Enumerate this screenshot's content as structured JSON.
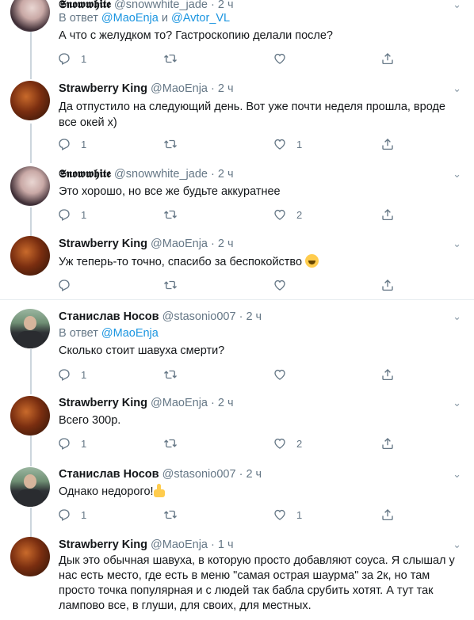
{
  "tweets": [
    {
      "avatar": "snowwhite",
      "name": "𝕾𝖓𝖔𝖜𝖜𝖍𝖎𝖙𝖊",
      "handle": "@snowwhite_jade",
      "dot": "·",
      "time": "2 ч",
      "reply_prefix": "В ответ ",
      "reply_users": [
        "@MaoEnja",
        "@Avtor_VL"
      ],
      "reply_and": " и ",
      "text": "А что с желудком то? Гастроскопию делали после?",
      "replies": "1",
      "retweets": "",
      "likes": ""
    },
    {
      "avatar": "strawberry",
      "name": "Strawberry King",
      "handle": "@MaoEnja",
      "dot": "·",
      "time": "2 ч",
      "text": "Да отпустило на следующий день. Вот уже почти неделя прошла, вроде все окей х)",
      "replies": "1",
      "retweets": "",
      "likes": "1"
    },
    {
      "avatar": "snowwhite",
      "name": "𝕾𝖓𝖔𝖜𝖜𝖍𝖎𝖙𝖊",
      "handle": "@snowwhite_jade",
      "dot": "·",
      "time": "2 ч",
      "text": "Это хорошо, но все же будьте аккуратнее",
      "replies": "1",
      "retweets": "",
      "likes": "2"
    },
    {
      "avatar": "strawberry",
      "name": "Strawberry King",
      "handle": "@MaoEnja",
      "dot": "·",
      "time": "2 ч",
      "text": "Уж теперь-то точно, спасибо за беспокойство ",
      "emoji": "grinning-face-emoji",
      "replies": "",
      "retweets": "",
      "likes": ""
    },
    {
      "avatar": "stas",
      "name": "Станислав Носов",
      "handle": "@stasonio007",
      "dot": "·",
      "time": "2 ч",
      "reply_prefix": "В ответ ",
      "reply_users": [
        "@MaoEnja"
      ],
      "text": "Сколько стоит шавуха смерти?",
      "replies": "1",
      "retweets": "",
      "likes": ""
    },
    {
      "avatar": "strawberry",
      "name": "Strawberry King",
      "handle": "@MaoEnja",
      "dot": "·",
      "time": "2 ч",
      "text": "Всего 300р.",
      "replies": "1",
      "retweets": "",
      "likes": "2"
    },
    {
      "avatar": "stas",
      "name": "Станислав Носов",
      "handle": "@stasonio007",
      "dot": "·",
      "time": "2 ч",
      "text": "Однако недорого!",
      "emoji": "thumbs-up-emoji",
      "replies": "1",
      "retweets": "",
      "likes": "1"
    },
    {
      "avatar": "strawberry",
      "name": "Strawberry King",
      "handle": "@MaoEnja",
      "dot": "·",
      "time": "1 ч",
      "text": "Дык это обычная шавуха, в которую просто добавляют соуса. Я слышал у нас есть место, где есть в меню \"самая острая шаурма\" за 2к, но там просто точка популярная и с людей так бабла срубить хотят. А тут так лампово все, в глуши, для своих, для местных.",
      "replies": "",
      "retweets": "",
      "likes": ""
    }
  ],
  "colors": {
    "link": "#1b95e0",
    "muted": "#657786",
    "divider": "#e6ecf0",
    "thread": "#ccd6dd"
  },
  "icons": {
    "reply": "reply-icon",
    "retweet": "retweet-icon",
    "like": "heart-icon",
    "share": "share-icon",
    "menu": "chevron-down-icon"
  }
}
